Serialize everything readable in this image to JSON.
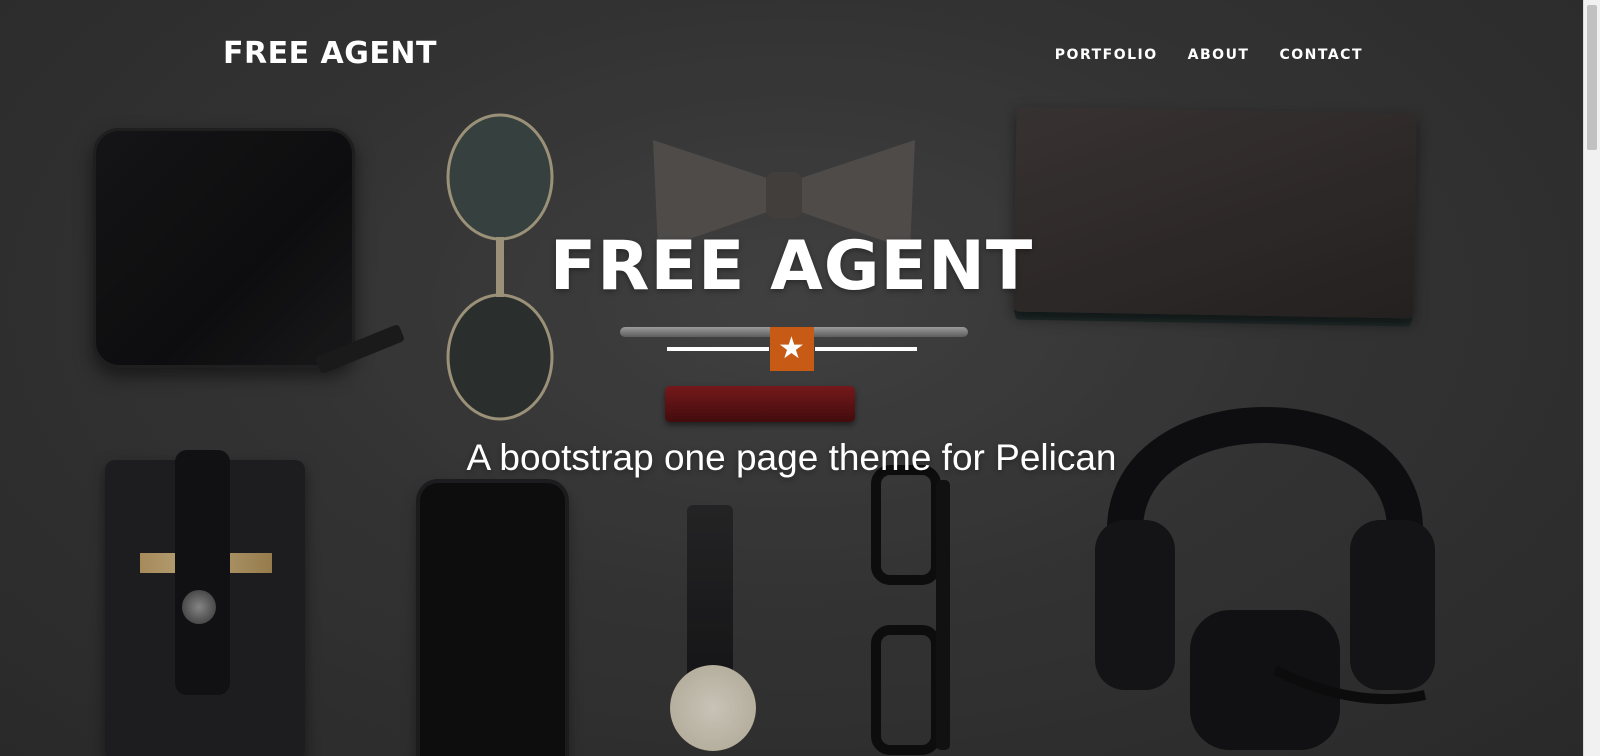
{
  "navbar": {
    "brand": "FREE AGENT",
    "items": [
      {
        "label": "PORTFOLIO"
      },
      {
        "label": "ABOUT"
      },
      {
        "label": "CONTACT"
      }
    ]
  },
  "intro": {
    "title": "FREE AGENT",
    "divider_icon": "star-icon",
    "subtitle": "A bootstrap one page theme for Pelican"
  },
  "colors": {
    "accent": "#c75a14",
    "text": "#ffffff",
    "background": "#3a3a3a"
  }
}
